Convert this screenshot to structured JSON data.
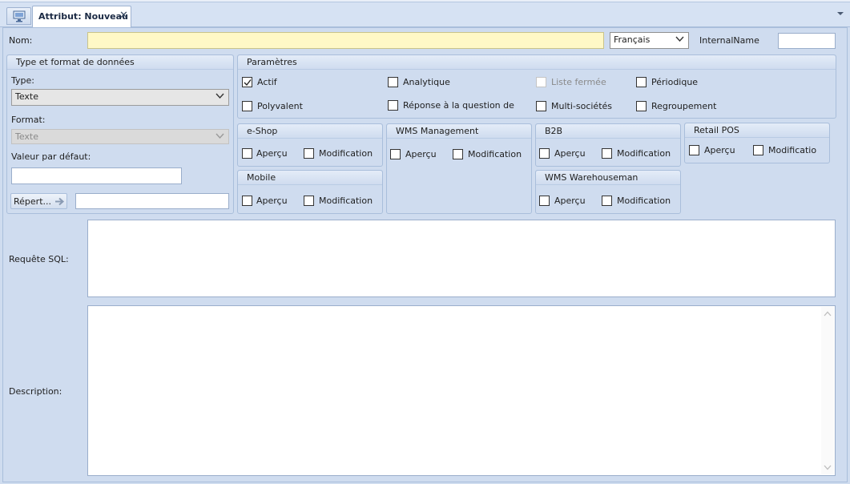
{
  "tabs": {
    "home_icon": "monitor-icon",
    "active_tab": {
      "title": "Attribut: Nouveau",
      "close_glyph": "✕"
    }
  },
  "form": {
    "name_label": "Nom:",
    "name_value": "",
    "language_selected": "Français",
    "internal_name_label": "InternalName",
    "internal_name_value": ""
  },
  "data_type_group": {
    "title": "Type et format de données",
    "type_label": "Type:",
    "type_value": "Texte",
    "format_label": "Format:",
    "format_value": "Texte",
    "default_value_label": "Valeur par défaut:",
    "default_value": "",
    "repertoire_button": "Répert...",
    "repertoire_value": ""
  },
  "params_group": {
    "title": "Paramètres",
    "checkboxes": [
      {
        "label": "Actif",
        "checked": true,
        "enabled": true
      },
      {
        "label": "Analytique",
        "checked": false,
        "enabled": true
      },
      {
        "label": "Liste fermée",
        "checked": false,
        "enabled": false
      },
      {
        "label": "Périodique",
        "checked": false,
        "enabled": true
      },
      {
        "label": "Polyvalent",
        "checked": false,
        "enabled": true
      },
      {
        "label": "Réponse à la question de",
        "checked": false,
        "enabled": true
      },
      {
        "label": "Multi-sociétés",
        "checked": false,
        "enabled": true
      },
      {
        "label": "Regroupement",
        "checked": false,
        "enabled": true
      }
    ]
  },
  "channels": {
    "eshop": {
      "title": "e-Shop",
      "preview": "Aperçu",
      "modification": "Modification"
    },
    "wms_management": {
      "title": "WMS Management",
      "preview": "Aperçu",
      "modification": "Modification"
    },
    "b2b": {
      "title": "B2B",
      "preview": "Aperçu",
      "modification": "Modification"
    },
    "retail_pos": {
      "title": "Retail POS",
      "preview": "Aperçu",
      "modification": "Modificatio"
    },
    "mobile": {
      "title": "Mobile",
      "preview": "Aperçu",
      "modification": "Modification"
    },
    "wms_warehouseman": {
      "title": "WMS Warehouseman",
      "preview": "Aperçu",
      "modification": "Modification"
    }
  },
  "sql": {
    "label": "Requête SQL:",
    "value": ""
  },
  "description": {
    "label": "Description:",
    "value": ""
  },
  "colors": {
    "background": "#cfdcef",
    "name_field": "#fff8c6",
    "border": "#a9bedb"
  }
}
